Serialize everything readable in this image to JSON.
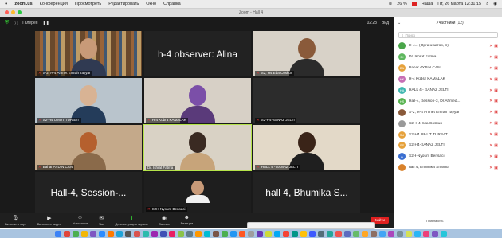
{
  "menubar": {
    "app": "zoom.us",
    "items": [
      "Конференция",
      "Просмотреть",
      "Редактировать",
      "Окно",
      "Справка"
    ],
    "battery": "26 %",
    "record_label": "Наша",
    "clock": "Пт, 26 марта 12:31:15"
  },
  "titlebar": {
    "title": "Zoom - Hall 4"
  },
  "meeting": {
    "layout_label": "Галерея",
    "timer": "02:23",
    "view_label": "Вид"
  },
  "tiles": [
    {
      "name": "S-2, H-4 Ahmet Emrah Tayyar"
    },
    {
      "name": "",
      "text": "h-4 observer: Alina"
    },
    {
      "name": "S2, H4 Eda Coskun"
    },
    {
      "name": "S2-H4 UMUT TURBAT"
    },
    {
      "name": "H-4 Kübra KAMALAK"
    },
    {
      "name": "S2-H4-SANAZ JELTI"
    },
    {
      "name": "Bahar AYDIN CAN"
    },
    {
      "name": "Dr. Ishrat Fatma"
    },
    {
      "name": "HALL 4 - SANAZ JELTI"
    },
    {
      "name": "",
      "text": "Hall-4, Session-..."
    },
    {
      "name": "S2H-Nyoum Bensaci"
    },
    {
      "name": "",
      "text": "hall 4, Bhumika S..."
    }
  ],
  "controls": [
    {
      "label": "Включить звук",
      "icon": "mic-muted-icon"
    },
    {
      "label": "Включить видео",
      "icon": "video-muted-icon"
    },
    {
      "label": "Участники",
      "icon": "participants-icon"
    },
    {
      "label": "Чат",
      "icon": "chat-icon"
    },
    {
      "label": "Демонстрация экрана",
      "icon": "share-screen-icon"
    },
    {
      "label": "Запись",
      "icon": "record-icon"
    },
    {
      "label": "Реакции",
      "icon": "reactions-icon"
    }
  ],
  "end_label": "Выйти",
  "panel": {
    "title": "Участники (12)",
    "search_placeholder": "Поиск",
    "participants": [
      {
        "initials": "",
        "name": "H-4... (Организатор, я)",
        "color": "#4aa64a"
      },
      {
        "initials": "DI",
        "name": "Dr. Ishrat Fatma",
        "color": "#5fb85f"
      },
      {
        "initials": "BA",
        "name": "Bahar AYDIN CAN",
        "color": "#e6a23c"
      },
      {
        "initials": "HK",
        "name": "H-4 Kübra KAMALAK",
        "color": "#c76fb5"
      },
      {
        "initials": "HA",
        "name": "HALL 4 - SANAZ JELTI",
        "color": "#3fb7b0"
      },
      {
        "initials": "HS",
        "name": "Hall-4, Session-3, Dr.Ahmed...",
        "color": "#57b34f"
      },
      {
        "initials": "",
        "name": "S-2, H-4 Ahmet Emrah Tayyar",
        "color": "#8a5a3a"
      },
      {
        "initials": "",
        "name": "S2, H4 Eda Coskun",
        "color": "#9a9a9a"
      },
      {
        "initials": "SU",
        "name": "S2-H4 UMUT TURBAT",
        "color": "#e6a23c"
      },
      {
        "initials": "SS",
        "name": "S2-H4-SANAZ JELTI",
        "color": "#e6a23c"
      },
      {
        "initials": "A",
        "name": "S2H-Nyoum Bensaci",
        "color": "#3b6fd1"
      },
      {
        "initials": "",
        "name": "hall 4, Bhumika Sharma",
        "color": "#d9822b"
      }
    ]
  },
  "invite_label": "Пригласить"
}
